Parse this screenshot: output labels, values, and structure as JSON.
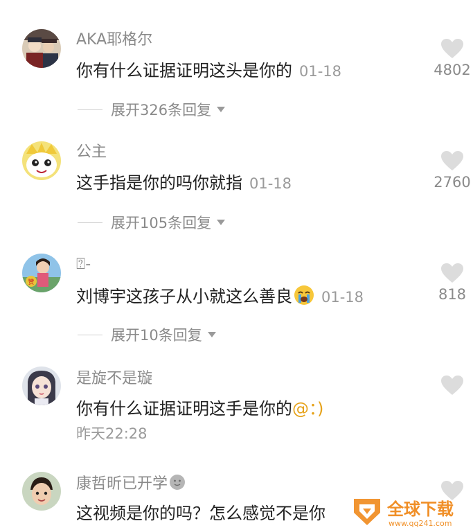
{
  "comments": [
    {
      "username": "AKA耶格尔",
      "text": "你有什么证据证明这头是你的",
      "date": "01-18",
      "likes": "4802",
      "replies": "展开326条回复",
      "avatar_icon": "anime-characters-avatar"
    },
    {
      "username": "公主",
      "text": "这手指是你的吗你就指",
      "date": "01-18",
      "likes": "2760",
      "replies": "展开105条回复",
      "avatar_icon": "cartoon-face-avatar"
    },
    {
      "username": "⍰-",
      "text": "刘博宇这孩子从小就这么善良",
      "emoji": "crying-emoji",
      "date": "01-18",
      "likes": "818",
      "replies": "展开10条回复",
      "avatar_icon": "photo-avatar"
    },
    {
      "username": "是旋不是璇",
      "text": "你有什么证据证明这手是你的",
      "mention": "@：)",
      "time": "昨天22:28",
      "avatar_icon": "anime-girl-avatar"
    },
    {
      "username": "康哲昕已开学",
      "status_emoji": "grey-face-emoji",
      "text": "这视频是你的吗？怎么感觉不是你",
      "avatar_icon": "child-photo-avatar"
    }
  ],
  "watermark": {
    "title": "全球下载",
    "url": "www.qq241.com"
  },
  "colors": {
    "accent": "#e6a21a",
    "text": "#222222",
    "muted": "#8a8a8a",
    "heart": "#dcdcdc"
  }
}
